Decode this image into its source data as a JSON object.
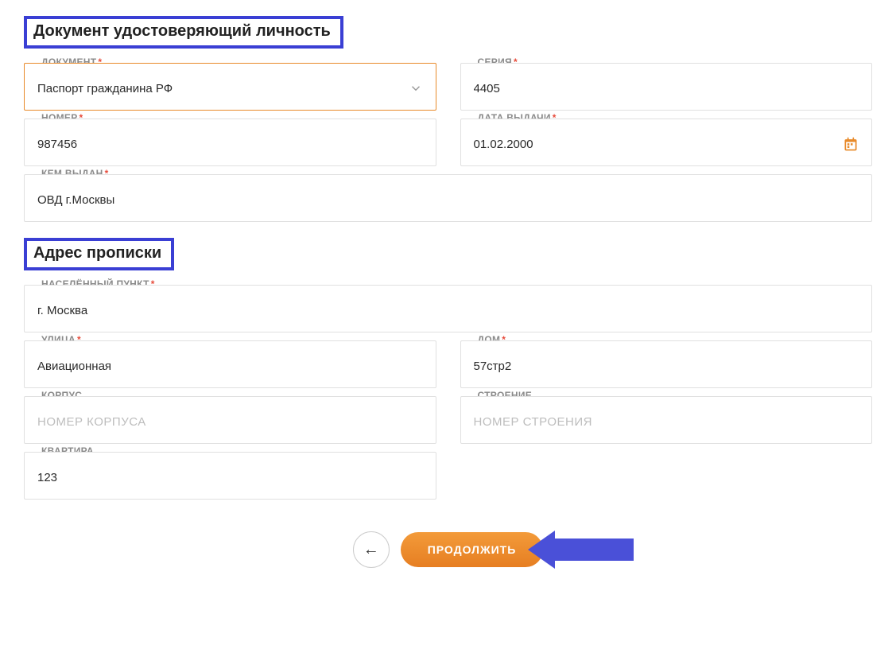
{
  "identity": {
    "section_title": "Документ удостоверяющий личность",
    "document_label": "ДОКУМЕНТ",
    "document_value": "Паспорт гражданина РФ",
    "series_label": "СЕРИЯ",
    "series_value": "4405",
    "number_label": "НОМЕР",
    "number_value": "987456",
    "issue_date_label": "ДАТА ВЫДАЧИ",
    "issue_date_value": "01.02.2000",
    "issued_by_label": "КЕМ ВЫДАН",
    "issued_by_value": "ОВД г.Москвы"
  },
  "address": {
    "section_title": "Адрес прописки",
    "city_label": "НАСЕЛЁННЫЙ ПУНКТ",
    "city_value": "г. Москва",
    "street_label": "УЛИЦА",
    "street_value": "Авиационная",
    "house_label": "ДОМ",
    "house_value": "57стр2",
    "korpus_label": "КОРПУС",
    "korpus_placeholder": "НОМЕР КОРПУСА",
    "building_label": "СТРОЕНИЕ",
    "building_placeholder": "НОМЕР СТРОЕНИЯ",
    "apartment_label": "КВАРТИРА",
    "apartment_value": "123"
  },
  "buttons": {
    "back_icon": "←",
    "continue_label": "ПРОДОЛЖИТЬ"
  },
  "asterisk": "*"
}
